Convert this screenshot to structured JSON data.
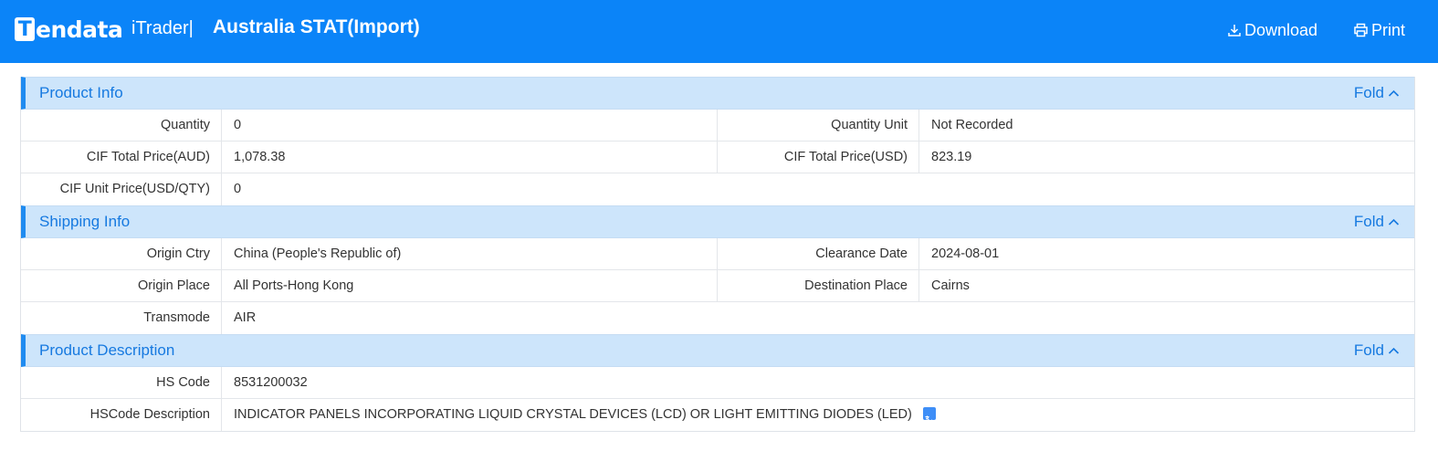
{
  "header": {
    "logo_letter": "T",
    "logo_text": "endata",
    "product": "iTrader|",
    "title": "Australia STAT(Import)",
    "download_label": "Download",
    "print_label": "Print"
  },
  "colors": {
    "header_bg": "#0b84f8",
    "section_bg": "#cde5fb",
    "section_accent": "#1f8bf0",
    "section_text": "#1679e0"
  },
  "fold_label": "Fold",
  "product_info": {
    "title": "Product Info",
    "quantity_label": "Quantity",
    "quantity_value": "0",
    "quantity_unit_label": "Quantity Unit",
    "quantity_unit_value": "Not Recorded",
    "cif_total_aud_label": "CIF Total Price(AUD)",
    "cif_total_aud_value": "1,078.38",
    "cif_total_usd_label": "CIF Total Price(USD)",
    "cif_total_usd_value": "823.19",
    "cif_unit_label": "CIF Unit Price(USD/QTY)",
    "cif_unit_value": "0"
  },
  "shipping_info": {
    "title": "Shipping Info",
    "origin_ctry_label": "Origin Ctry",
    "origin_ctry_value": "China (People's Republic of)",
    "clearance_date_label": "Clearance Date",
    "clearance_date_value": "2024-08-01",
    "origin_place_label": "Origin Place",
    "origin_place_value": "All Ports-Hong Kong",
    "destination_place_label": "Destination Place",
    "destination_place_value": "Cairns",
    "transmode_label": "Transmode",
    "transmode_value": "AIR"
  },
  "product_description": {
    "title": "Product Description",
    "hs_code_label": "HS Code",
    "hs_code_value": "8531200032",
    "hscode_desc_label": "HSCode Description",
    "hscode_desc_value": "INDICATOR PANELS INCORPORATING LIQUID CRYSTAL DEVICES (LCD) OR LIGHT EMITTING DIODES (LED)",
    "translate_icon": "translate-icon"
  }
}
